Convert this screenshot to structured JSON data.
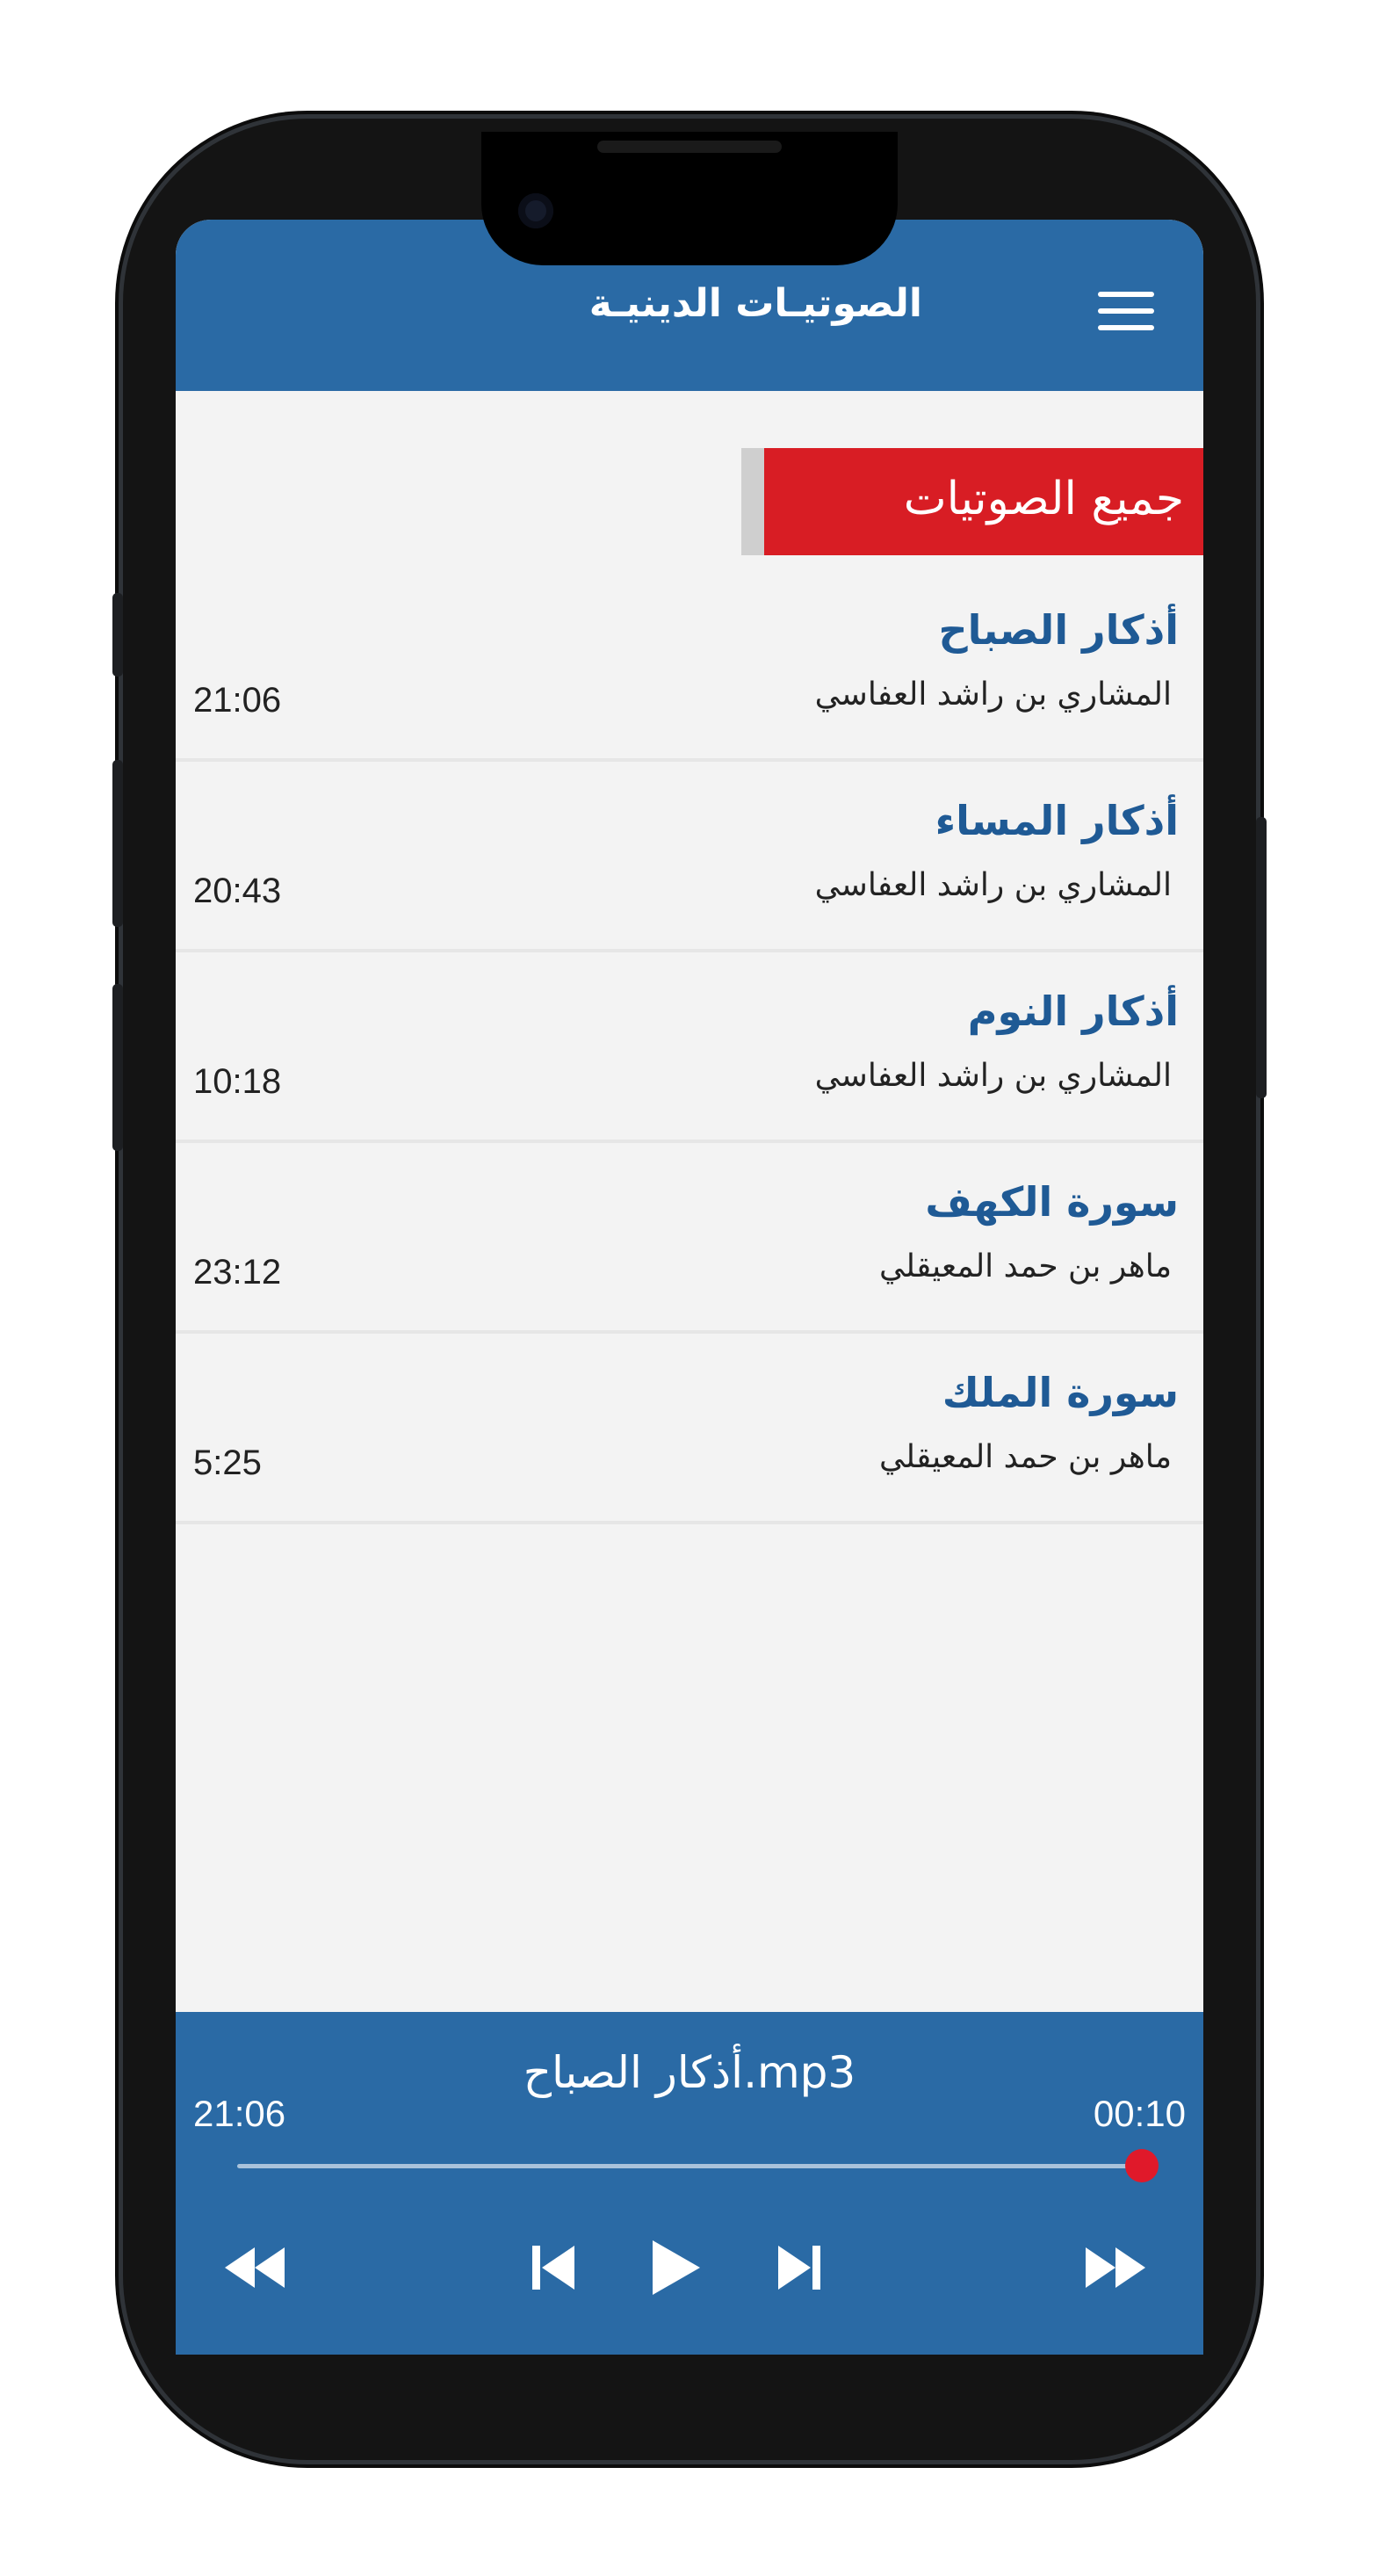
{
  "app": {
    "title": "الصوتيـات الدينيـة",
    "accent_color": "#2a6aa5",
    "banner_color": "#d81d24",
    "menu_icon": "hamburger-menu-icon"
  },
  "section": {
    "label": "جميع الصوتيات"
  },
  "tracks": [
    {
      "title": "أذكار الصباح",
      "reciter": "المشاري بن راشد العفاسي",
      "duration": "21:06"
    },
    {
      "title": "أذكار المساء",
      "reciter": "المشاري بن راشد العفاسي",
      "duration": "20:43"
    },
    {
      "title": "أذكار النوم",
      "reciter": "المشاري بن راشد العفاسي",
      "duration": "10:18"
    },
    {
      "title": "سورة الكهف",
      "reciter": "ماهر بن حمد المعيقلي",
      "duration": "23:12"
    },
    {
      "title": "سورة الملك",
      "reciter": "ماهر بن حمد المعيقلي",
      "duration": "5:25"
    }
  ],
  "player": {
    "track_name": "أذكار الصباح.mp3",
    "total_time": "21:06",
    "elapsed_time": "00:10",
    "progress_fraction": 0.008,
    "controls": [
      "fast-rewind-icon",
      "skip-previous-icon",
      "play-icon",
      "skip-next-icon",
      "fast-forward-icon"
    ]
  }
}
